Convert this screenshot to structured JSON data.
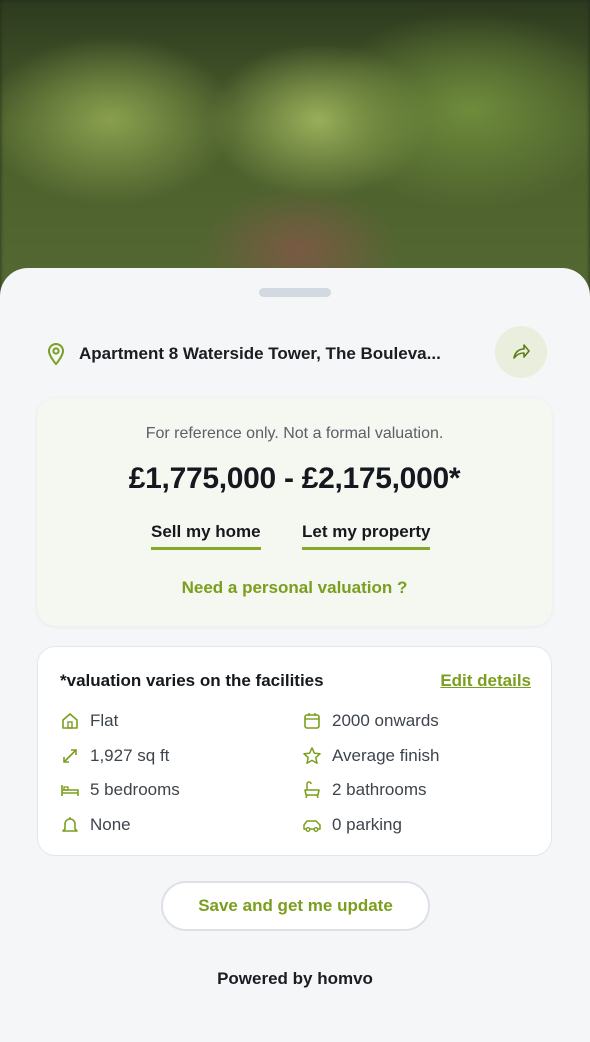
{
  "address": {
    "text": "Apartment 8 Waterside Tower, The Bouleva..."
  },
  "valuation": {
    "disclaimer": "For reference only. Not a formal valuation.",
    "price_range": "£1,775,000 - £2,175,000*",
    "sell_label": "Sell my home",
    "let_label": "Let my property",
    "personal_label": "Need a personal valuation ?"
  },
  "facilities": {
    "title": "*valuation varies on the facilities",
    "edit_label": "Edit details",
    "items": [
      {
        "icon": "home-icon",
        "label": "Flat"
      },
      {
        "icon": "calendar-icon",
        "label": "2000 onwards"
      },
      {
        "icon": "expand-arrows-icon",
        "label": "1,927 sq ft"
      },
      {
        "icon": "star-icon",
        "label": "Average finish"
      },
      {
        "icon": "bed-icon",
        "label": "5 bedrooms"
      },
      {
        "icon": "bath-icon",
        "label": "2 bathrooms"
      },
      {
        "icon": "bell-icon",
        "label": "None"
      },
      {
        "icon": "car-icon",
        "label": "0 parking"
      }
    ]
  },
  "actions": {
    "save_label": "Save and get me update"
  },
  "footer": {
    "powered_by": "Powered by homvo"
  },
  "colors": {
    "accent": "#7b9e1e",
    "accent_underline": "#86a82a",
    "sheet_bg": "#f4f6f8"
  }
}
